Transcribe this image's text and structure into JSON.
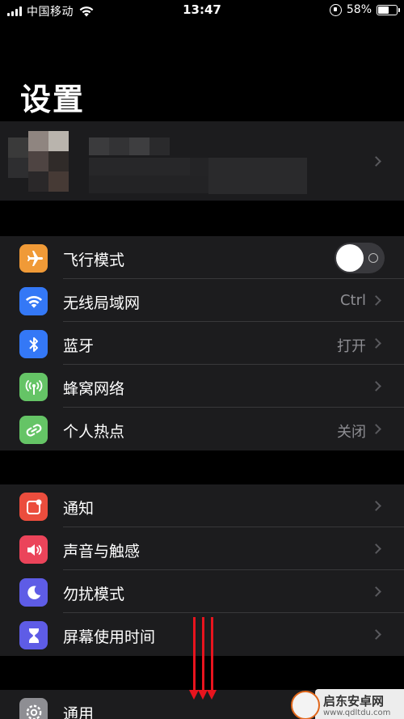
{
  "status_bar": {
    "carrier": "中国移动",
    "time": "13:47",
    "battery_percent": "58%",
    "battery_level": 0.58
  },
  "title": "设置",
  "group1": {
    "airplane": {
      "label": "飞行模式",
      "icon": "airplane-icon",
      "color": "#f09a37",
      "toggle_on": false
    },
    "wifi": {
      "label": "无线局域网",
      "value": "Ctrl",
      "icon": "wifi-icon",
      "color": "#3478f6"
    },
    "bluetooth": {
      "label": "蓝牙",
      "value": "打开",
      "icon": "bluetooth-icon",
      "color": "#3478f6"
    },
    "cellular": {
      "label": "蜂窝网络",
      "icon": "antenna-icon",
      "color": "#65c466"
    },
    "hotspot": {
      "label": "个人热点",
      "value": "关闭",
      "icon": "link-icon",
      "color": "#65c466"
    }
  },
  "group2": {
    "notifications": {
      "label": "通知",
      "icon": "notification-icon",
      "color": "#eb4d3d"
    },
    "sounds": {
      "label": "声音与触感",
      "icon": "speaker-icon",
      "color": "#eb445a"
    },
    "dnd": {
      "label": "勿扰模式",
      "icon": "moon-icon",
      "color": "#5e5ce6"
    },
    "screentime": {
      "label": "屏幕使用时间",
      "icon": "hourglass-icon",
      "color": "#5e5ce6"
    }
  },
  "group3": {
    "general": {
      "label": "通用",
      "icon": "gear-icon",
      "color": "#8e8e93"
    }
  },
  "watermark": {
    "title": "启东安卓网",
    "subtitle": "www.qdltdu.com"
  }
}
